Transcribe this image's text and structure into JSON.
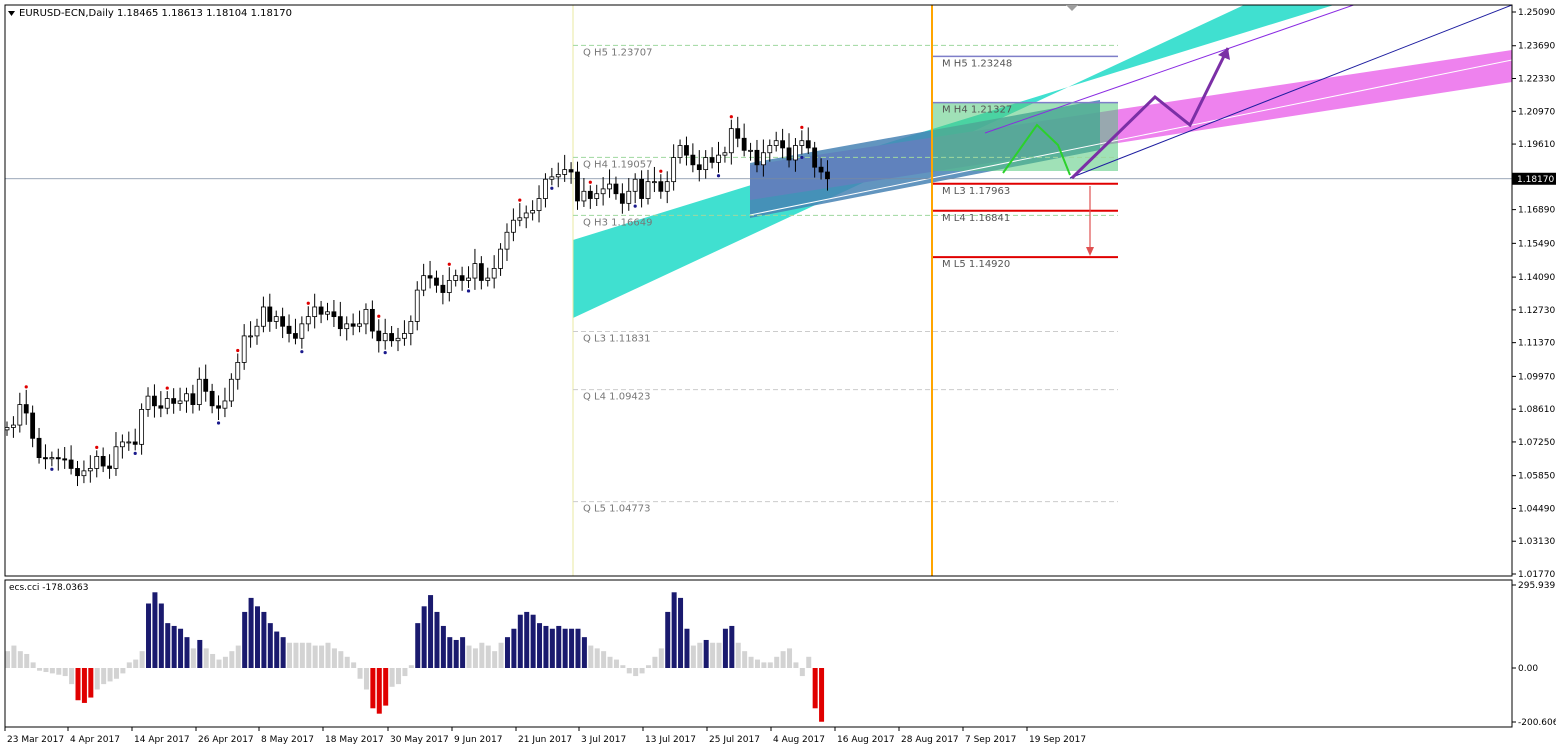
{
  "header": {
    "symbol": "EURUSD-ECN,Daily",
    "ohlc": "1.18465 1.18613 1.18104 1.18170"
  },
  "indicator": {
    "title": "ecs.cci -178.0363",
    "axis_labels": [
      "295.9391",
      "0.00",
      "-200.6065"
    ]
  },
  "chart_data": [
    {
      "type": "candlestick",
      "instrument": "EURUSD-ECN",
      "timeframe": "Daily",
      "current_price": 1.1817,
      "ylim": [
        1.0125,
        1.255
      ],
      "y_ticks": [
        1.2509,
        1.2369,
        1.2233,
        1.2097,
        1.1961,
        1.1817,
        1.1689,
        1.1549,
        1.1409,
        1.1273,
        1.1137,
        1.0997,
        1.0861,
        1.0725,
        1.0585,
        1.0449,
        1.0313,
        1.0177
      ],
      "x_ticks": [
        "23 Mar 2017",
        "4 Apr 2017",
        "14 Apr 2017",
        "26 Apr 2017",
        "8 May 2017",
        "18 May 2017",
        "30 May 2017",
        "9 Jun 2017",
        "21 Jun 2017",
        "3 Jul 2017",
        "13 Jul 2017",
        "25 Jul 2017",
        "4 Aug 2017",
        "16 Aug 2017",
        "28 Aug 2017",
        "7 Sep 2017",
        "19 Sep 2017"
      ],
      "q_levels": [
        {
          "label": "H5",
          "value": 1.23707,
          "text": "Q  H5 1.23707"
        },
        {
          "label": "H4",
          "value": 1.19057,
          "text": "Q  H4 1.19057"
        },
        {
          "label": "H3",
          "value": 1.16649,
          "text": "Q  H3 1.16649"
        },
        {
          "label": "L3",
          "value": 1.11831,
          "text": "Q  L3 1.11831"
        },
        {
          "label": "L4",
          "value": 1.09423,
          "text": "Q  L4 1.09423"
        },
        {
          "label": "L5",
          "value": 1.04773,
          "text": "Q  L5 1.04773"
        }
      ],
      "m_levels": [
        {
          "label": "H5",
          "value": 1.23248,
          "text": "M  H5 1.23248"
        },
        {
          "label": "H4",
          "value": 1.21327,
          "text": "M  H4 1.21327"
        },
        {
          "label": "L3",
          "value": 1.17963,
          "text": "M  L3 1.17963"
        },
        {
          "label": "L4",
          "value": 1.16841,
          "text": "M  L4 1.16841"
        },
        {
          "label": "L5",
          "value": 1.1492,
          "text": "M  L5 1.14920"
        }
      ],
      "closes": [
        1.0785,
        1.0795,
        1.088,
        1.0845,
        1.074,
        1.066,
        1.0655,
        1.066,
        1.0655,
        1.065,
        1.0615,
        1.0585,
        1.0605,
        1.0615,
        1.0665,
        1.0625,
        1.0615,
        1.0705,
        1.0725,
        1.0725,
        1.0715,
        1.086,
        1.0915,
        1.0875,
        1.0865,
        1.0905,
        1.0885,
        1.0895,
        1.0925,
        1.088,
        1.0985,
        1.0935,
        1.0875,
        1.0865,
        1.0895,
        1.0985,
        1.1055,
        1.1165,
        1.1165,
        1.1205,
        1.1285,
        1.1225,
        1.1245,
        1.1205,
        1.1175,
        1.1155,
        1.1215,
        1.1245,
        1.1285,
        1.1255,
        1.1265,
        1.1245,
        1.1195,
        1.1215,
        1.1205,
        1.1215,
        1.1275,
        1.1185,
        1.1145,
        1.1175,
        1.1145,
        1.1155,
        1.1175,
        1.1225,
        1.1355,
        1.1415,
        1.1405,
        1.1375,
        1.1345,
        1.1395,
        1.1415,
        1.1395,
        1.1405,
        1.1465,
        1.1395,
        1.1405,
        1.1445,
        1.1525,
        1.1595,
        1.1645,
        1.1655,
        1.1675,
        1.1685,
        1.1735,
        1.1815,
        1.1825,
        1.1835,
        1.1855,
        1.1845,
        1.1725,
        1.1765,
        1.1735,
        1.1755,
        1.1775,
        1.1795,
        1.1755,
        1.1715,
        1.1765,
        1.1815,
        1.1735,
        1.1805,
        1.1805,
        1.1765,
        1.1805,
        1.1905,
        1.1955,
        1.1915,
        1.1875,
        1.1855,
        1.1905,
        1.1885,
        1.1915,
        1.1925,
        1.2025,
        1.1985,
        1.1935,
        1.1935,
        1.1875,
        1.1925,
        1.1955,
        1.1975,
        1.1945,
        1.1895,
        1.1955,
        1.1975,
        1.1945,
        1.1865,
        1.1845,
        1.1817
      ],
      "cci_range": [
        -200.6065,
        295.9391
      ],
      "cci_histogram": [
        60,
        80,
        60,
        50,
        20,
        -10,
        -15,
        -20,
        -25,
        -30,
        -60,
        -120,
        -130,
        -110,
        -80,
        -60,
        -50,
        -40,
        -20,
        20,
        30,
        60,
        230,
        270,
        230,
        160,
        150,
        140,
        110,
        70,
        100,
        70,
        50,
        30,
        40,
        60,
        80,
        200,
        250,
        220,
        200,
        160,
        130,
        110,
        90,
        90,
        90,
        90,
        80,
        80,
        90,
        70,
        60,
        40,
        20,
        -40,
        -80,
        -150,
        -170,
        -140,
        -70,
        -60,
        -30,
        10,
        160,
        220,
        260,
        200,
        150,
        110,
        100,
        110,
        80,
        70,
        90,
        80,
        60,
        90,
        110,
        140,
        190,
        200,
        190,
        160,
        150,
        140,
        150,
        140,
        140,
        140,
        110,
        80,
        70,
        60,
        40,
        30,
        10,
        -20,
        -30,
        -20,
        10,
        40,
        70,
        200,
        270,
        250,
        140,
        80,
        90,
        100,
        90,
        90,
        140,
        150,
        90,
        60,
        40,
        30,
        20,
        20,
        40,
        60,
        70,
        20,
        -30,
        40,
        -150,
        -200
      ]
    }
  ]
}
